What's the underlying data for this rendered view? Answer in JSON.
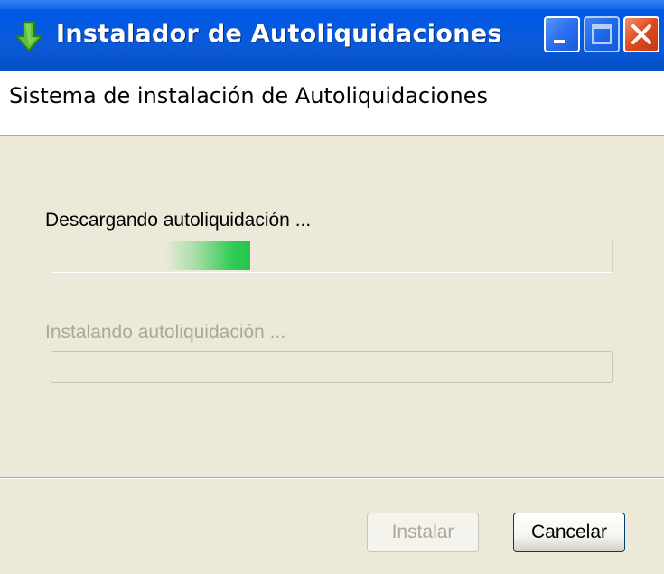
{
  "window": {
    "title": "Instalador de Autoliquidaciones",
    "title_icon": "green-down-arrow-icon",
    "controls": [
      "minimize-icon",
      "maximize-icon",
      "close-icon"
    ]
  },
  "header": {
    "title": "Sistema de instalación de Autoliquidaciones"
  },
  "steps": [
    {
      "label": "Descargando autoliquidación ...",
      "active": true,
      "progress_color": "#2fcc55"
    },
    {
      "label": "Instalando autoliquidación ...",
      "active": false
    }
  ],
  "buttons": {
    "install_label": "Instalar",
    "install_enabled": false,
    "cancel_label": "Cancelar",
    "cancel_enabled": true
  },
  "colors": {
    "titlebar": "#0058e6",
    "face": "#ece9d8",
    "disabled_text": "#aca899",
    "close_button": "#de4a1e"
  }
}
